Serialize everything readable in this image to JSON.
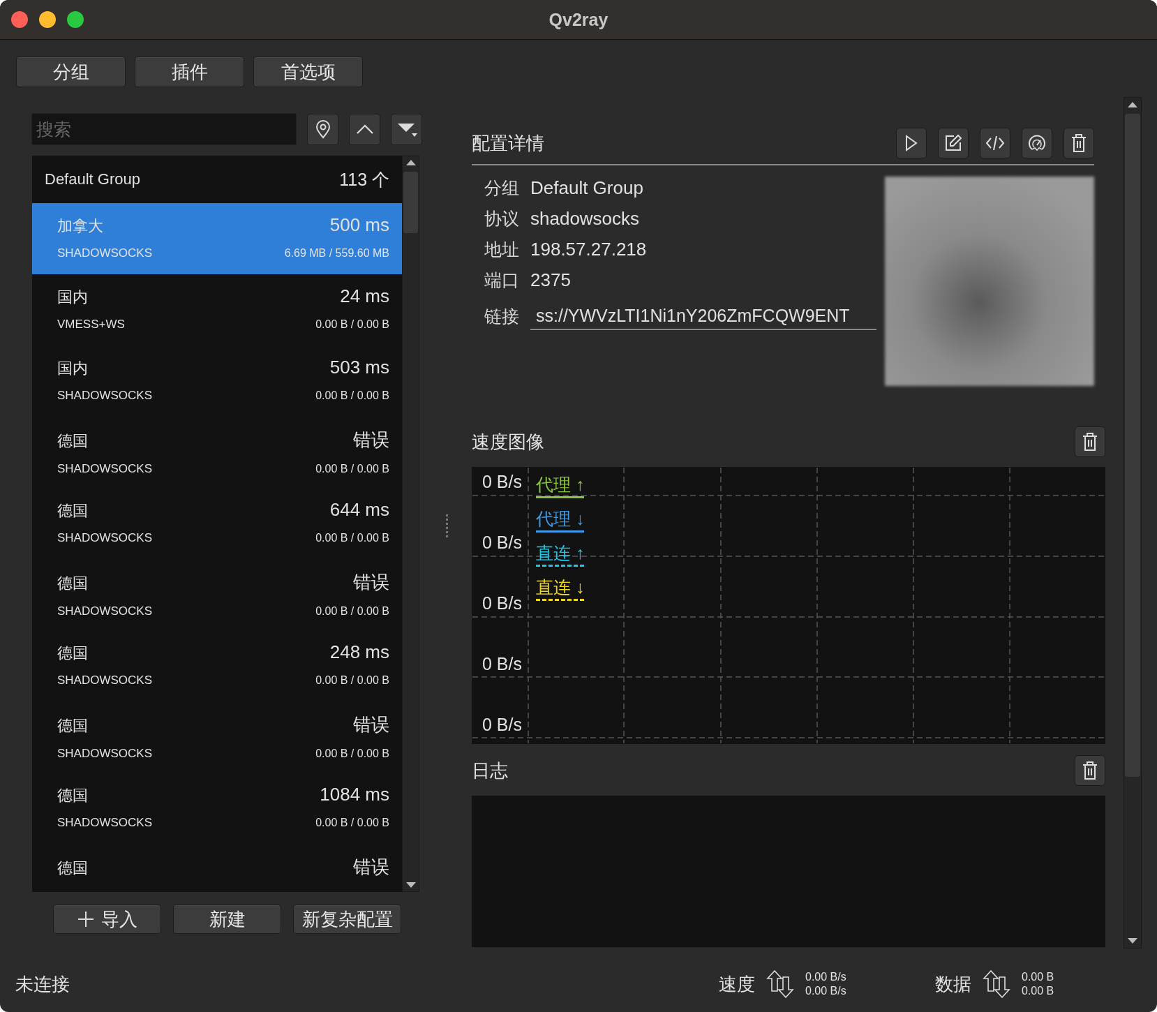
{
  "window": {
    "title": "Qv2ray"
  },
  "top_buttons": [
    "分组",
    "插件",
    "首选项"
  ],
  "search": {
    "placeholder": "搜索"
  },
  "group": {
    "name": "Default Group",
    "count": "113 个"
  },
  "connections": [
    {
      "name": "加拿大",
      "protocol": "SHADOWSOCKS",
      "latency": "500 ms",
      "traffic": "6.69 MB / 559.60 MB",
      "selected": true
    },
    {
      "name": "国内",
      "protocol": "VMESS+WS",
      "latency": "24 ms",
      "traffic": "0.00 B / 0.00 B",
      "selected": false
    },
    {
      "name": "国内",
      "protocol": "SHADOWSOCKS",
      "latency": "503 ms",
      "traffic": "0.00 B / 0.00 B",
      "selected": false
    },
    {
      "name": "德国",
      "protocol": "SHADOWSOCKS",
      "latency": "错误",
      "traffic": "0.00 B / 0.00 B",
      "selected": false
    },
    {
      "name": "德国",
      "protocol": "SHADOWSOCKS",
      "latency": "644 ms",
      "traffic": "0.00 B / 0.00 B",
      "selected": false
    },
    {
      "name": "德国",
      "protocol": "SHADOWSOCKS",
      "latency": "错误",
      "traffic": "0.00 B / 0.00 B",
      "selected": false
    },
    {
      "name": "德国",
      "protocol": "SHADOWSOCKS",
      "latency": "248 ms",
      "traffic": "0.00 B / 0.00 B",
      "selected": false
    },
    {
      "name": "德国",
      "protocol": "SHADOWSOCKS",
      "latency": "错误",
      "traffic": "0.00 B / 0.00 B",
      "selected": false
    },
    {
      "name": "德国",
      "protocol": "SHADOWSOCKS",
      "latency": "1084 ms",
      "traffic": "0.00 B / 0.00 B",
      "selected": false
    },
    {
      "name": "德国",
      "latency": "错误",
      "selected": false
    }
  ],
  "list_buttons": [
    {
      "kind": "add",
      "label": "导入"
    },
    {
      "kind": "plain",
      "label": "新建"
    },
    {
      "kind": "plain",
      "label": "新复杂配置"
    }
  ],
  "details": {
    "title": "配置详情",
    "fields": [
      {
        "label": "分组",
        "value": "Default Group"
      },
      {
        "label": "协议",
        "value": "shadowsocks"
      },
      {
        "label": "地址",
        "value": "198.57.27.218"
      },
      {
        "label": "端口",
        "value": "2375"
      }
    ],
    "link": {
      "label": "链接",
      "value": "ss://YWVzLTI1Ni1nY206ZmFCQW9ENT"
    }
  },
  "speed_chart": {
    "title": "速度图像",
    "y_labels": [
      "0 B/s",
      "0 B/s",
      "0 B/s",
      "0 B/s",
      "0 B/s"
    ],
    "legend": [
      {
        "label": "代理 ↑",
        "color": "#8cc63f",
        "kind": "solid"
      },
      {
        "label": "代理 ↓",
        "color": "#3d9be9",
        "kind": "solid"
      },
      {
        "label": "直连 ↑",
        "color": "#1ec8e6",
        "kind": "dotted"
      },
      {
        "label": "直连 ↓",
        "color": "#f0d820",
        "kind": "dotted"
      }
    ]
  },
  "log": {
    "title": "日志"
  },
  "status": {
    "connection": "未连接",
    "speed": {
      "label": "速度",
      "up": "0.00 B/s",
      "down": "0.00 B/s"
    },
    "data": {
      "label": "数据",
      "up": "0.00 B",
      "down": "0.00 B"
    }
  }
}
